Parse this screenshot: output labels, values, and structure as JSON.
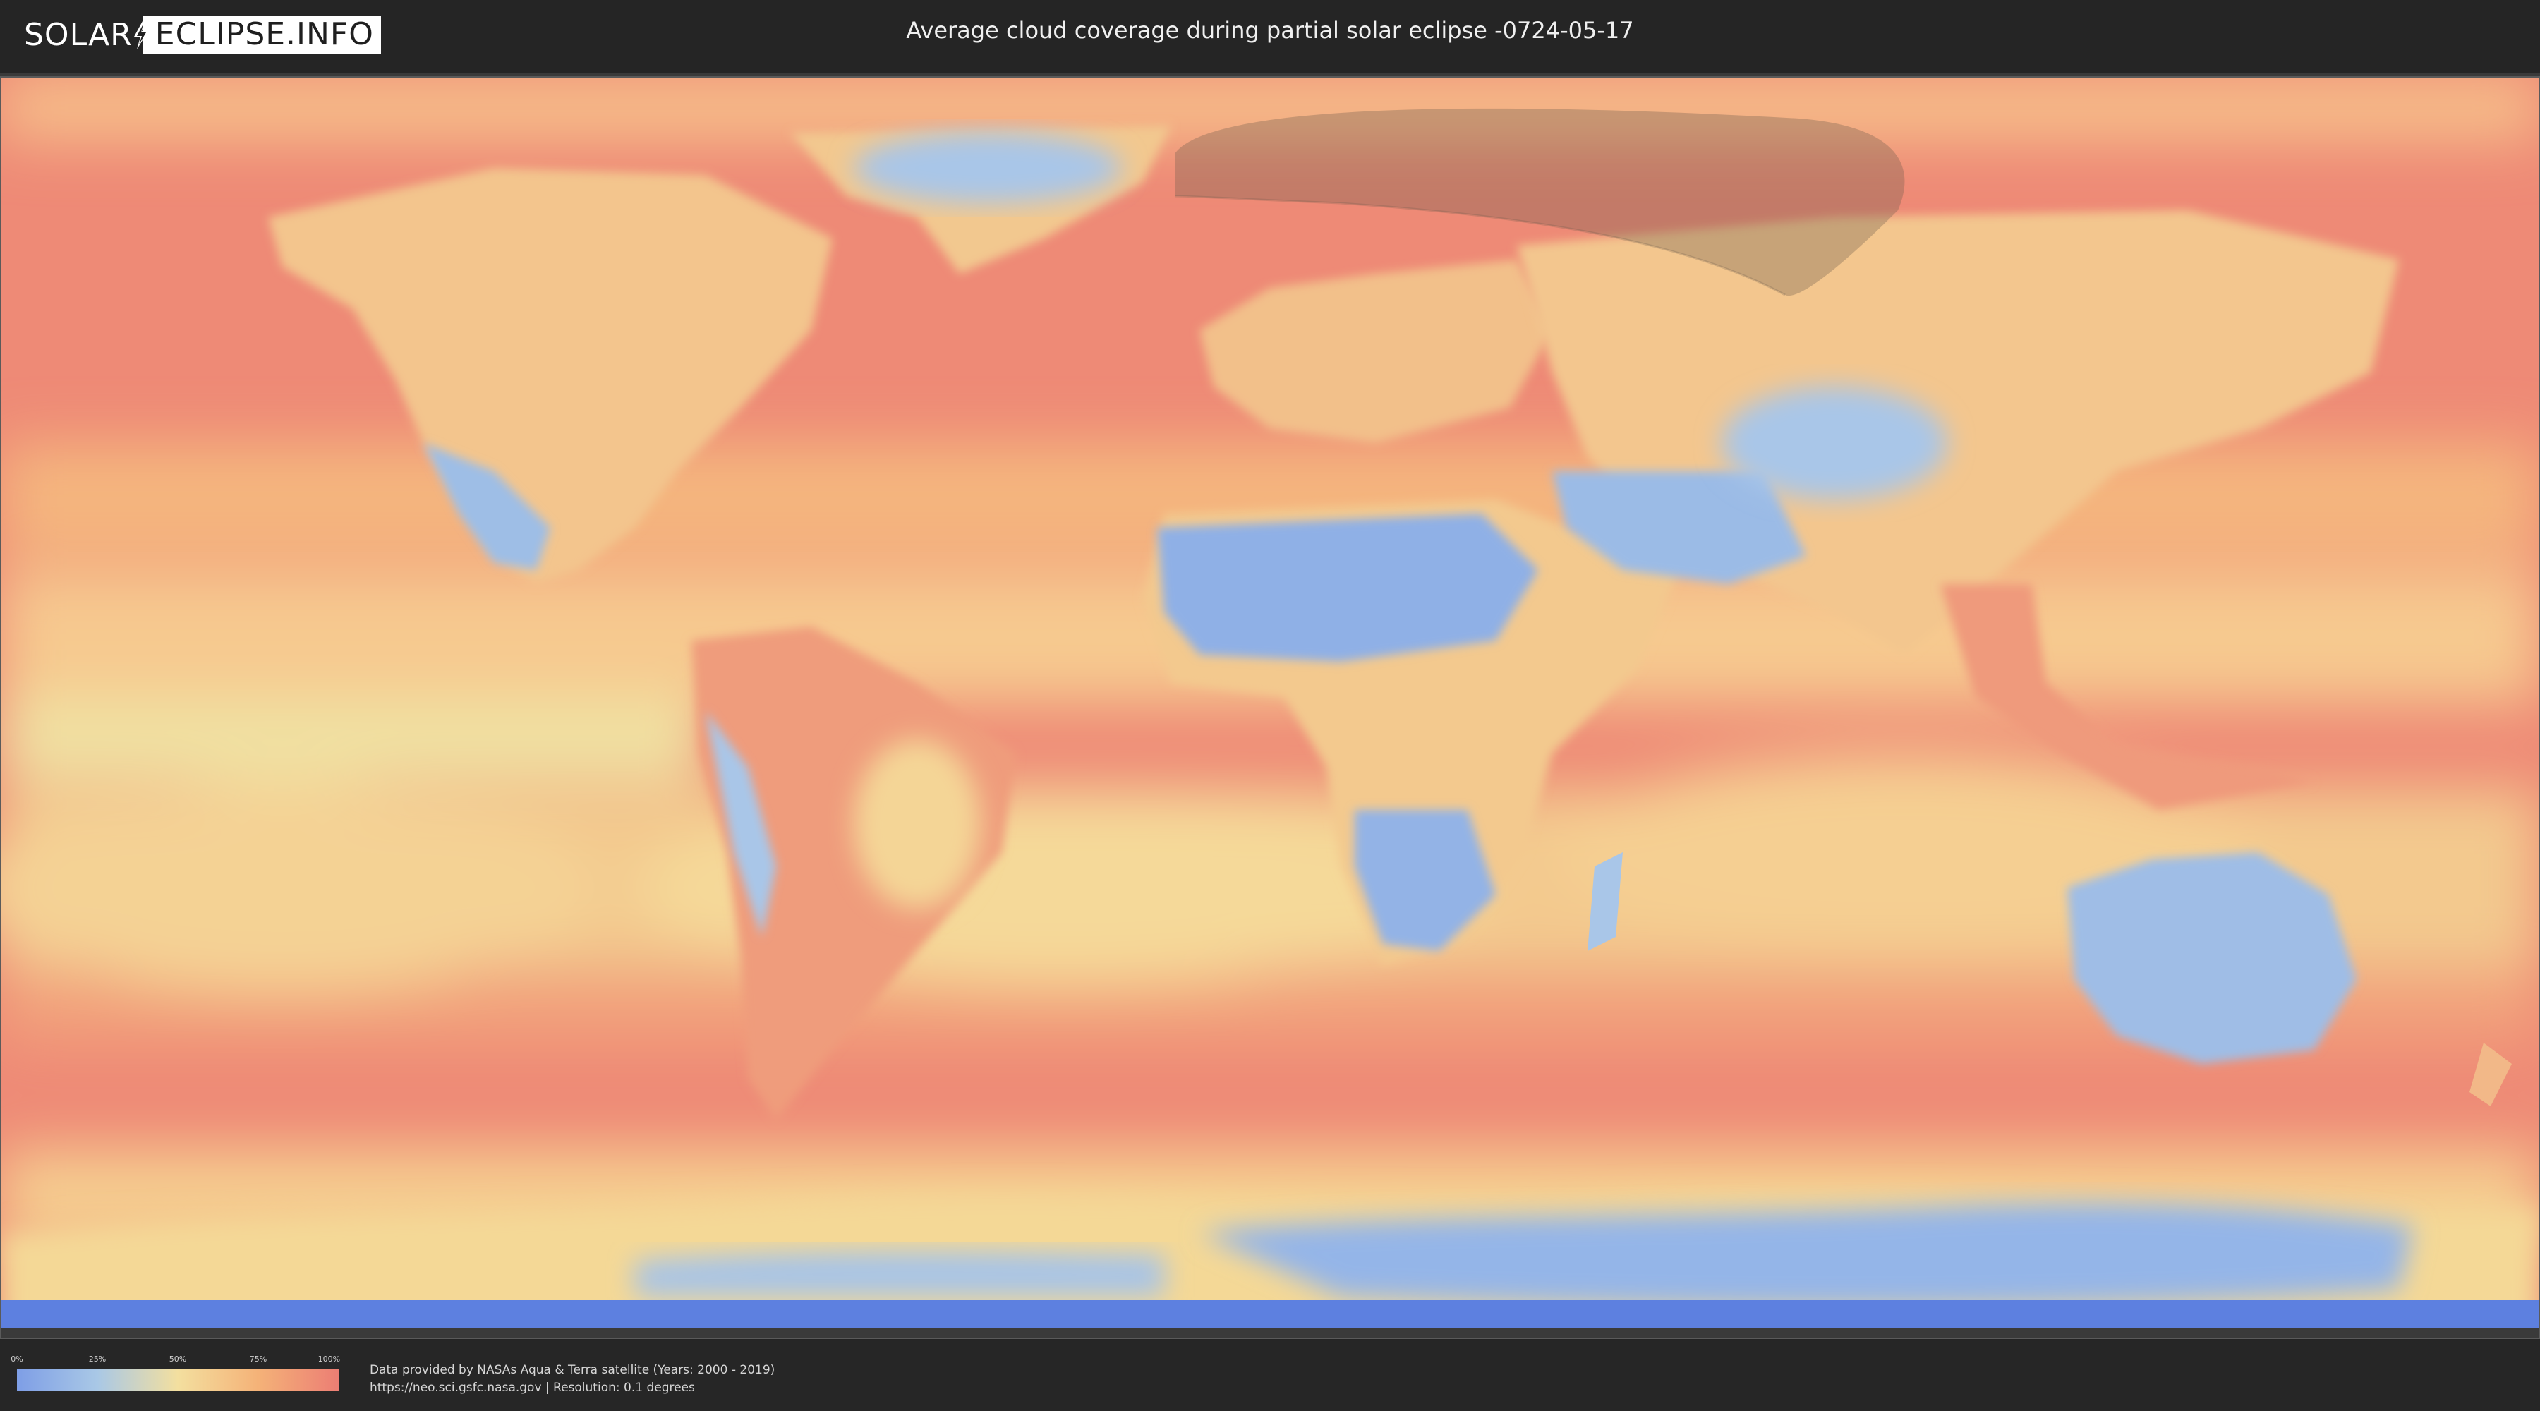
{
  "header": {
    "logo_part1": "SOLAR",
    "logo_part2": "ECLIPSE.INFO",
    "title": "Average cloud coverage during partial solar eclipse -0724-05-17"
  },
  "legend": {
    "ticks": [
      "0%",
      "25%",
      "50%",
      "75%",
      "100%"
    ],
    "colors": [
      "#7e9ee6",
      "#a9c8e6",
      "#f3df9f",
      "#f4b278",
      "#ec7e74"
    ]
  },
  "credits": {
    "line1": "Data provided by NASAs Aqua & Terra satellite (Years: 2000 - 2019)",
    "line2": "https://neo.sci.gsfc.nasa.gov | Resolution: 0.1 degrees"
  },
  "map": {
    "projection": "equirectangular",
    "eclipse_zone_color": "#6b5a4a",
    "ocean_color": "#ec7e74",
    "low_cloud_color": "#8fb0e6"
  }
}
